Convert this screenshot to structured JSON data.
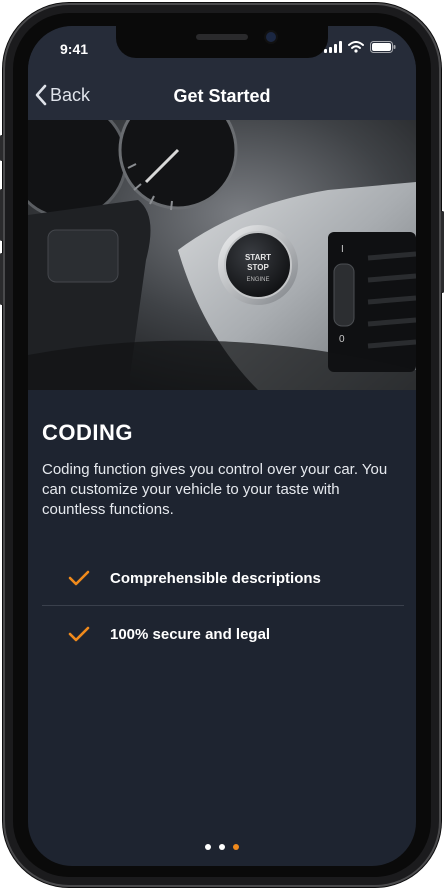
{
  "status": {
    "time": "9:41"
  },
  "nav": {
    "back_label": "Back",
    "title": "Get Started"
  },
  "hero": {
    "start_button_text_1": "START",
    "start_button_text_2": "STOP",
    "start_button_text_3": "ENGINE",
    "vent_marks": {
      "top": "I",
      "bottom": "0"
    }
  },
  "main": {
    "heading": "CODING",
    "description": "Coding function gives you control over your car. You can customize your vehicle to your taste with countless functions.",
    "features": [
      {
        "label": "Comprehensible descriptions",
        "icon": "checkmark-icon"
      },
      {
        "label": "100% secure and legal",
        "icon": "checkmark-icon"
      }
    ]
  },
  "pagination": {
    "total": 3,
    "active_index": 2
  },
  "colors": {
    "background": "#1e2430",
    "navbar": "#262c39",
    "accent": "#f08a1c",
    "dot_inactive": "#ffffff"
  }
}
